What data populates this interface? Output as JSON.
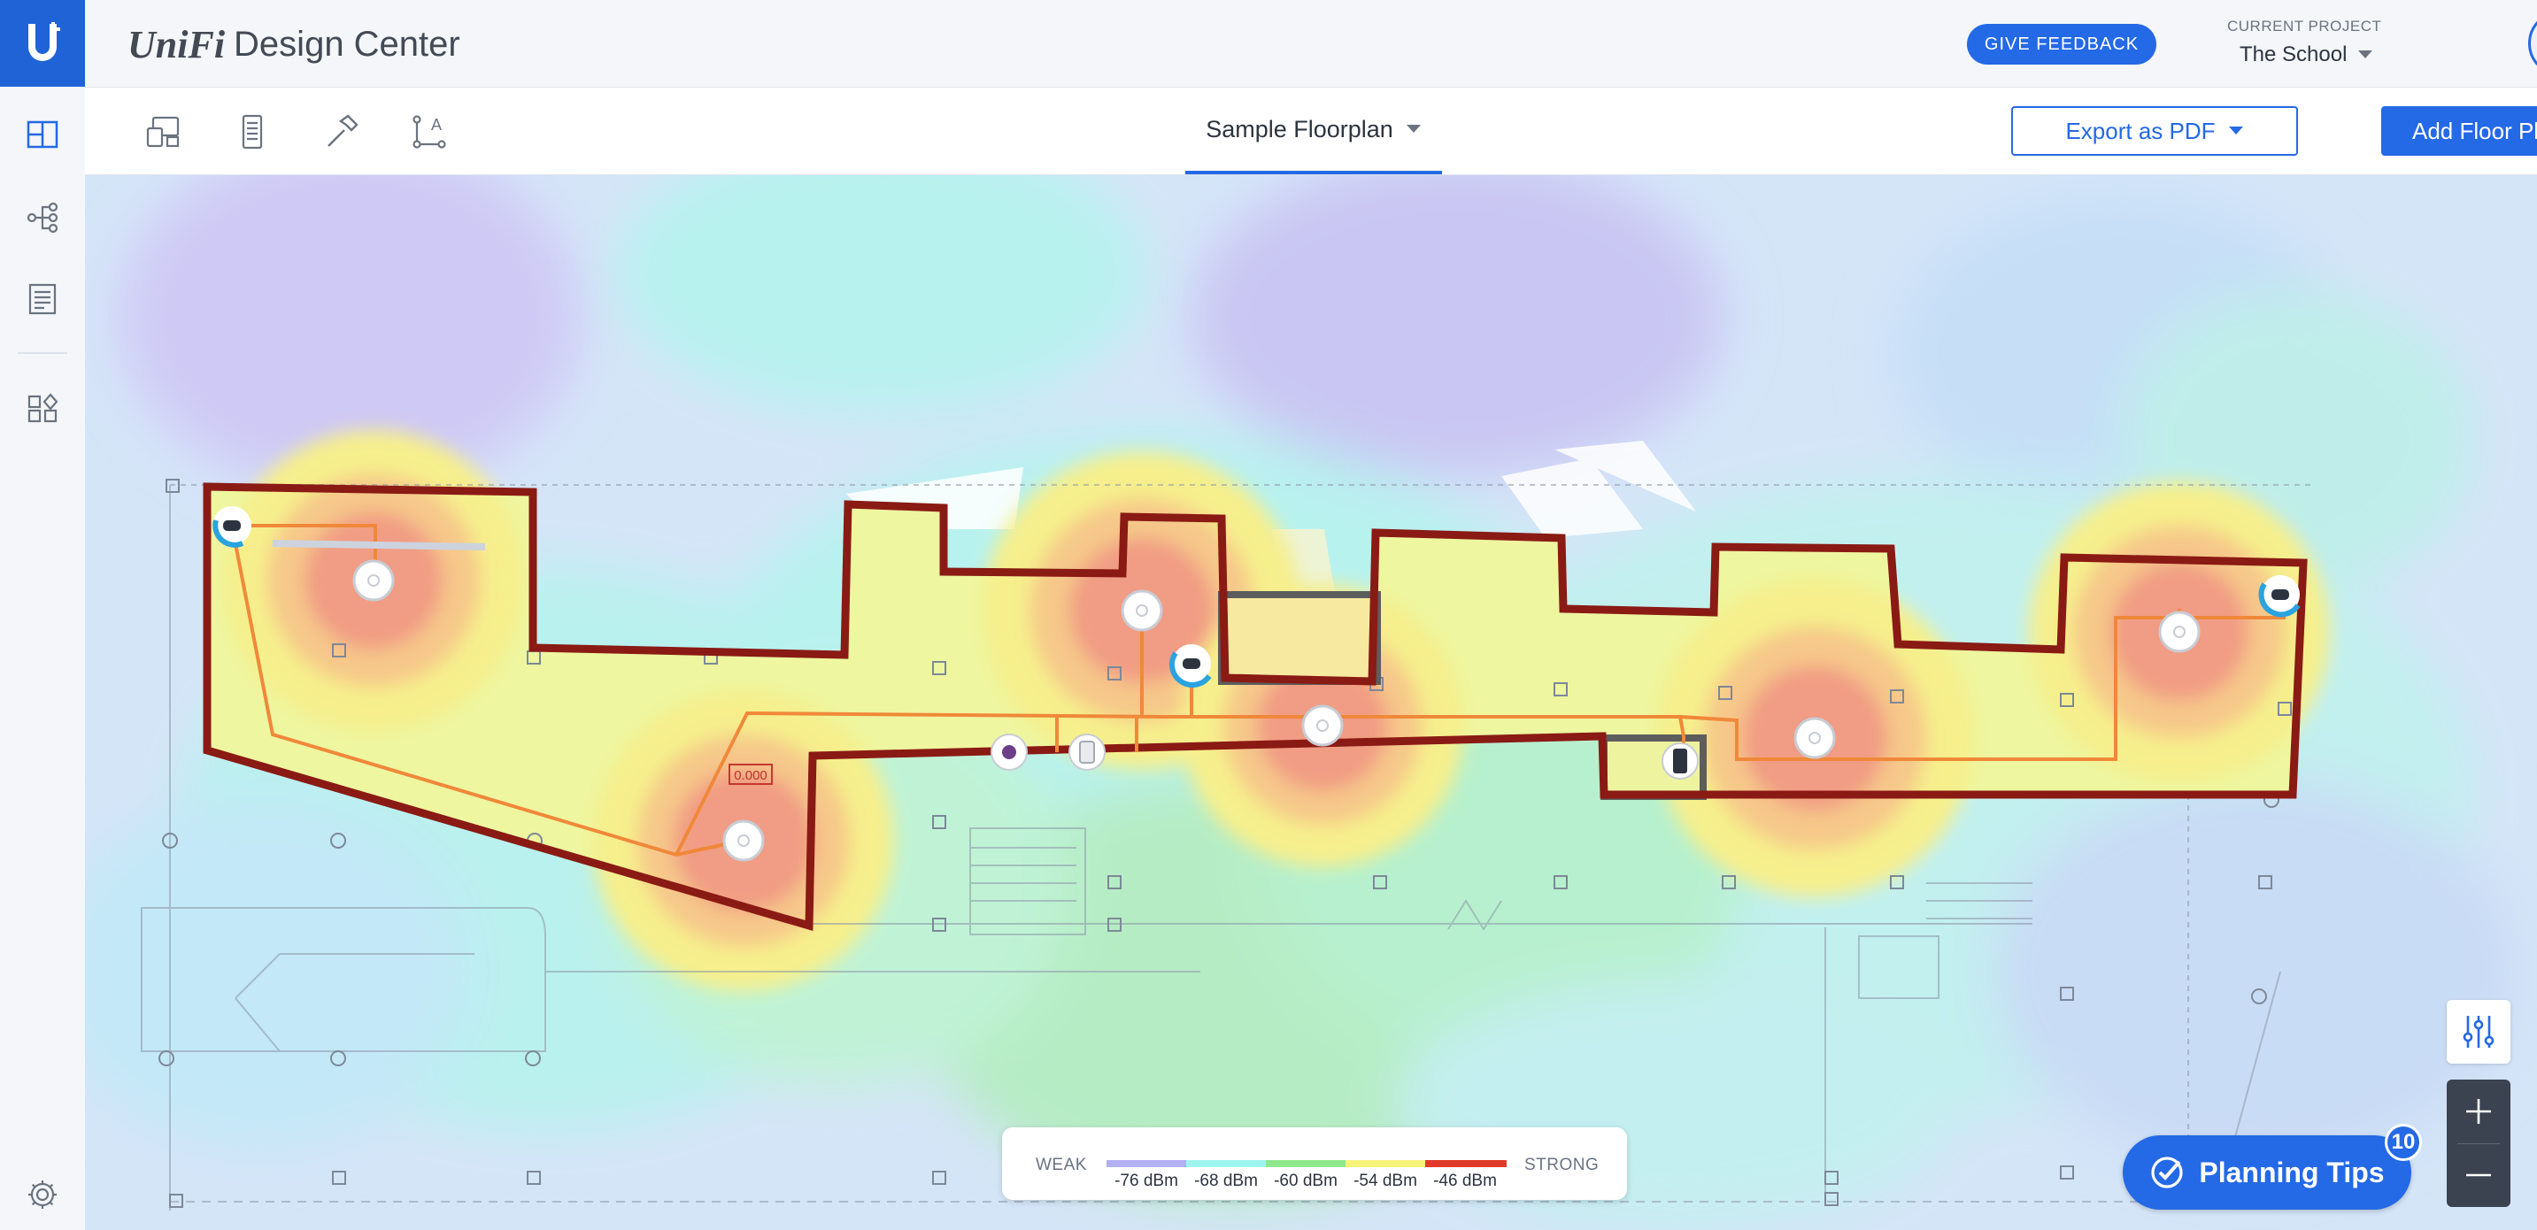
{
  "brand": {
    "logo_text": "UniFi",
    "app_name": "Design Center"
  },
  "header": {
    "feedback_label": "GIVE FEEDBACK",
    "project_label": "CURRENT PROJECT",
    "project_value": "The School"
  },
  "rail": {
    "items": [
      "floorplan-icon",
      "topology-icon",
      "bill-of-materials-icon",
      "widgets-icon",
      "settings-icon"
    ]
  },
  "toolbar": {
    "tools": [
      "devices-icon",
      "rack-icon",
      "hammer-icon",
      "measure-icon"
    ],
    "floor_name": "Sample Floorplan",
    "export_label": "Export as PDF",
    "add_floor_label": "Add Floor Plan"
  },
  "map": {
    "elevation_label": "0.000"
  },
  "legend": {
    "weak": "WEAK",
    "strong": "STRONG",
    "ticks": [
      "-76 dBm",
      "-68 dBm",
      "-60 dBm",
      "-54 dBm",
      "-46 dBm"
    ],
    "colors": [
      "#b3b0f2",
      "#9ef5ee",
      "#8fe88c",
      "#f6f37a",
      "#e23a2a"
    ]
  },
  "planning_tips": {
    "label": "Planning Tips",
    "count": "10"
  },
  "colors": {
    "accent": "#2469e6",
    "wall": "#8a1a14",
    "cable": "#f0883a"
  }
}
